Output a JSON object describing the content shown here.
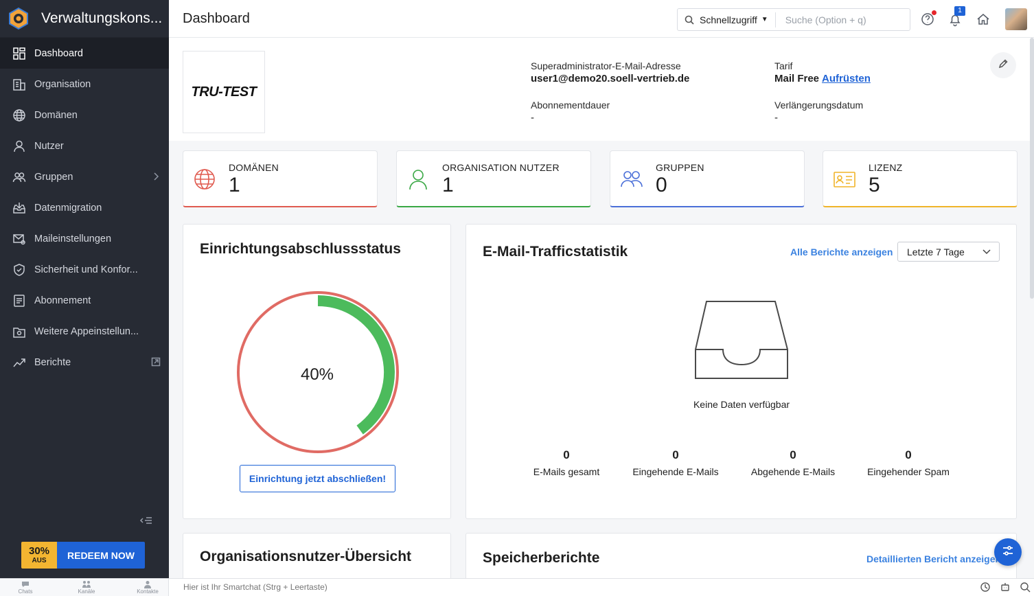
{
  "app": {
    "title": "Verwaltungskons..."
  },
  "sidebar": {
    "items": [
      {
        "label": "Dashboard",
        "icon": "dashboard-icon",
        "active": true
      },
      {
        "label": "Organisation",
        "icon": "building-icon"
      },
      {
        "label": "Domänen",
        "icon": "globe-icon"
      },
      {
        "label": "Nutzer",
        "icon": "user-icon"
      },
      {
        "label": "Gruppen",
        "icon": "group-icon"
      },
      {
        "label": "Datenmigration",
        "icon": "inbox-download-icon"
      },
      {
        "label": "Maileinstellungen",
        "icon": "mail-settings-icon"
      },
      {
        "label": "Sicherheit und Konfor...",
        "icon": "shield-icon"
      },
      {
        "label": "Abonnement",
        "icon": "subscription-icon"
      },
      {
        "label": "Weitere Appeinstellun...",
        "icon": "app-settings-icon"
      },
      {
        "label": "Berichte",
        "icon": "trend-icon"
      }
    ],
    "promo": {
      "percent": "30%",
      "off": "AUS",
      "cta": "REDEEM NOW"
    }
  },
  "header": {
    "page_title": "Dashboard",
    "quick_access": "Schnellzugriff",
    "search_placeholder": "Suche (Option + q)",
    "notification_count": "1"
  },
  "org": {
    "logo_text": "TRU-TEST",
    "admin_email_label": "Superadministrator-E-Mail-Adresse",
    "admin_email": "user1@demo20.soell-vertrieb.de",
    "plan_label": "Tarif",
    "plan": "Mail Free",
    "upgrade": "Aufrüsten",
    "subscription_label": "Abonnementdauer",
    "subscription_value": "-",
    "renewal_label": "Verlängerungsdatum",
    "renewal_value": "-"
  },
  "stats": [
    {
      "label": "DOMÄNEN",
      "value": "1",
      "color": "#e05a4f"
    },
    {
      "label": "ORGANISATION NUTZER",
      "value": "1",
      "color": "#3aa845"
    },
    {
      "label": "GRUPPEN",
      "value": "0",
      "color": "#4a6fd8"
    },
    {
      "label": "LIZENZ",
      "value": "5",
      "color": "#f0b429"
    }
  ],
  "setup": {
    "title": "Einrichtungsabschlussstatus",
    "progress": 40,
    "progress_label": "40%",
    "button": "Einrichtung jetzt abschließen!"
  },
  "traffic": {
    "title": "E-Mail-Trafficstatistik",
    "all_reports": "Alle Berichte anzeigen",
    "range": "Letzte 7 Tage",
    "empty": "Keine Daten verfügbar",
    "metrics": [
      {
        "value": "0",
        "label": "E-Mails gesamt"
      },
      {
        "value": "0",
        "label": "Eingehende E-Mails"
      },
      {
        "value": "0",
        "label": "Abgehende E-Mails"
      },
      {
        "value": "0",
        "label": "Eingehender Spam"
      }
    ]
  },
  "users_overview": {
    "title": "Organisationsnutzer-Übersicht"
  },
  "storage": {
    "title": "Speicherberichte",
    "detail_link": "Detaillierten Bericht anzeigen"
  },
  "bottombar": {
    "tabs": [
      "Chats",
      "Kanäle",
      "Kontakte"
    ],
    "smartchat_placeholder": "Hier ist Ihr Smartchat (Strg + Leertaste)"
  },
  "colors": {
    "accent": "#1f63d6",
    "sidebar_bg": "#272b34",
    "progress_fill": "#4cbb5c",
    "progress_track": "#e06b64"
  }
}
